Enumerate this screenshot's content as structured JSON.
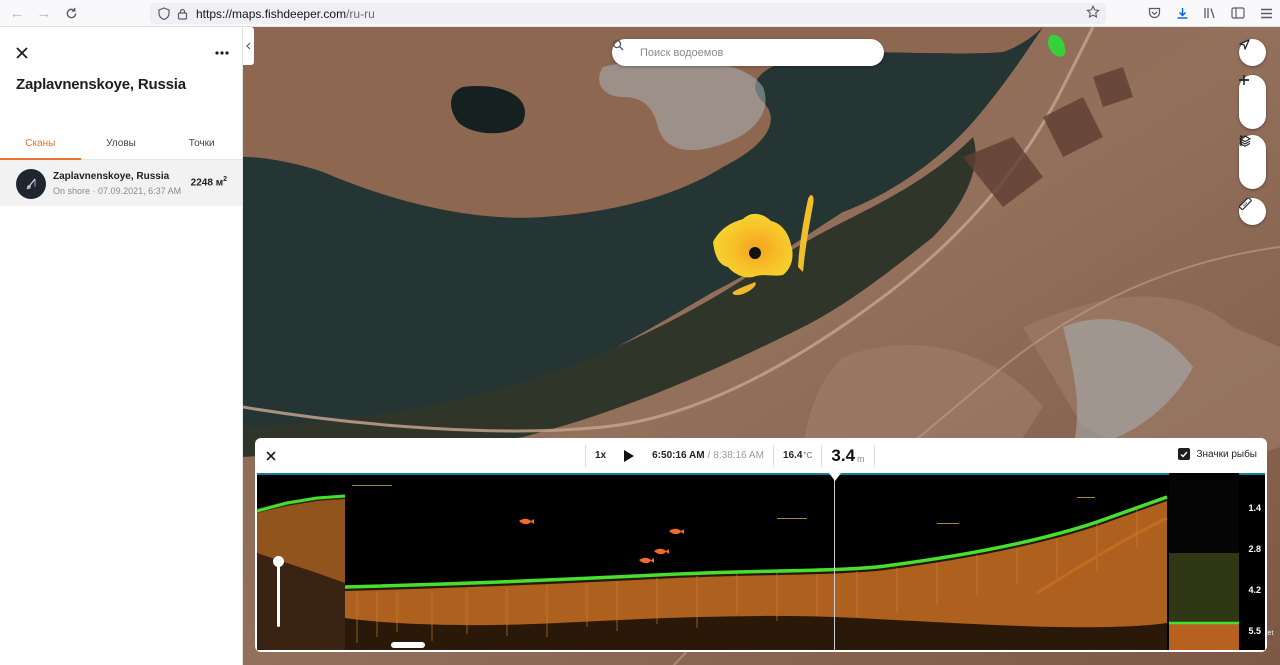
{
  "browser": {
    "url_host": "https://maps.fishdeeper.com",
    "url_path": "/ru-ru"
  },
  "panel": {
    "title": "Zaplavnenskoye, Russia",
    "tabs": [
      {
        "label": "Сканы",
        "active": true
      },
      {
        "label": "Уловы",
        "active": false
      },
      {
        "label": "Точки",
        "active": false
      }
    ],
    "scans": [
      {
        "name": "Zaplavnenskoye, Russia",
        "mode": "On shore",
        "datetime": "07.09.2021, 6:37 AM",
        "area": "2248 м",
        "area_sup": "2"
      }
    ]
  },
  "map": {
    "search_placeholder": "Поиск водоемов",
    "credit": "let"
  },
  "sonar": {
    "speed": "1x",
    "time_current": "6:50:16 AM",
    "time_separator": "/",
    "time_total": "8:38:16 AM",
    "temperature": "16.4",
    "temperature_unit": "°C",
    "depth": "3.4",
    "depth_unit": "m",
    "fish_icons_label": "Значки рыбы",
    "fish_icons_checked": true,
    "depth_scale": [
      "1.4",
      "2.8",
      "4.2",
      "5.5"
    ]
  },
  "colors": {
    "accent": "#e87330",
    "sonar_bottom_green": "#3fe02f",
    "sonar_echo_orange": "#d9822b"
  }
}
